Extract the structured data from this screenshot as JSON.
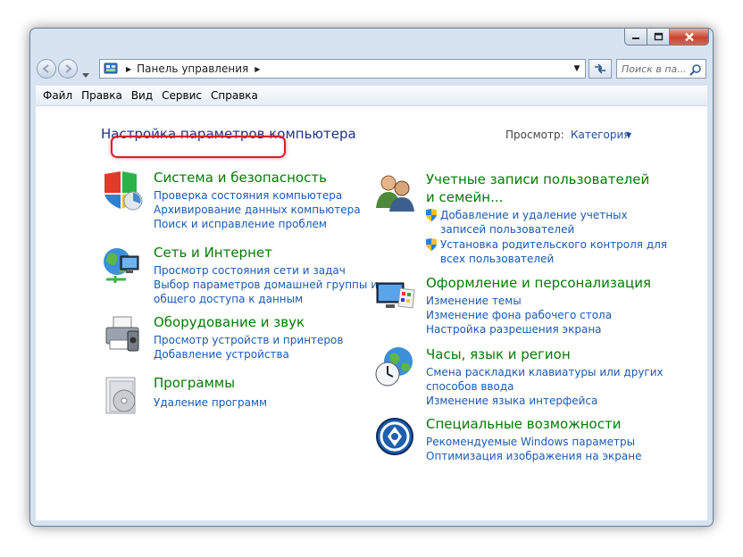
{
  "nav": {
    "breadcrumb": "Панель управления",
    "search_placeholder": "Поиск в па..."
  },
  "menu": [
    "Файл",
    "Правка",
    "Вид",
    "Сервис",
    "Справка"
  ],
  "header": {
    "title": "Настройка параметров компьютера",
    "view_label": "Просмотр:",
    "view_value": "Категория"
  },
  "categories_left": [
    {
      "icon": "shield-icon",
      "title": "Система и безопасность",
      "links": [
        "Проверка состояния компьютера",
        "Архивирование данных компьютера",
        "Поиск и исправление проблем"
      ]
    },
    {
      "icon": "network-icon",
      "title": "Сеть и Интернет",
      "links": [
        "Просмотр состояния сети и задач",
        "Выбор параметров домашней группы и",
        "общего доступа к данным"
      ]
    },
    {
      "icon": "printer-icon",
      "title": "Оборудование и звук",
      "links": [
        "Просмотр устройств и принтеров",
        "Добавление устройства"
      ]
    },
    {
      "icon": "programs-icon",
      "title": "Программы",
      "links": [
        "Удаление программ"
      ]
    }
  ],
  "categories_right": [
    {
      "icon": "users-icon",
      "title_lines": [
        "Учетные записи пользователей",
        "и семейн..."
      ],
      "links": [
        {
          "lines": [
            "Добавление и удаление учетных",
            "записей пользователей"
          ]
        },
        {
          "lines": [
            "Установка родительского контроля для",
            "всех пользователей"
          ]
        }
      ]
    },
    {
      "icon": "appearance-icon",
      "title": "Оформление и персонализация",
      "links": [
        "Изменение темы",
        "Изменение фона рабочего стола",
        "Настройка разрешения экрана"
      ]
    },
    {
      "icon": "clock-globe-icon",
      "title": "Часы, язык и регион",
      "links": [
        "Смена раскладки клавиатуры или других",
        "способов ввода",
        "Изменение языка интерфейса"
      ]
    },
    {
      "icon": "accessibility-icon",
      "title": "Специальные возможности",
      "links": [
        "Рекомендуемые Windows параметры",
        "Оптимизация изображения на экране"
      ]
    }
  ]
}
